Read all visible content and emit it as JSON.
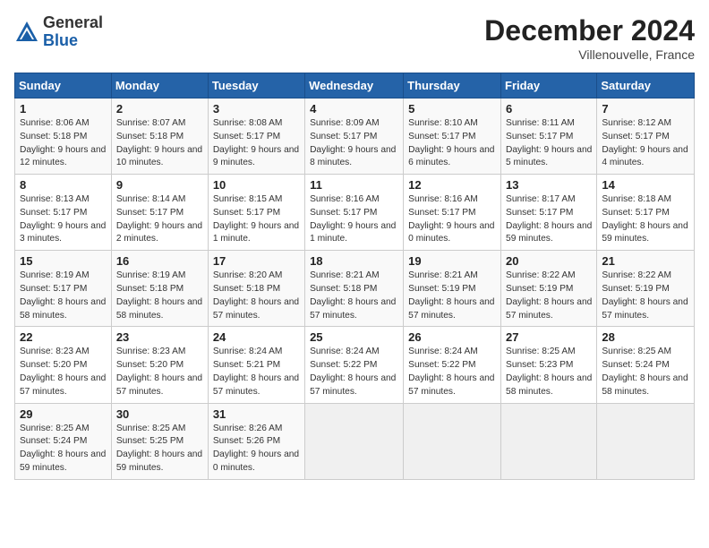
{
  "header": {
    "logo_general": "General",
    "logo_blue": "Blue",
    "month_title": "December 2024",
    "location": "Villenouvelle, France"
  },
  "days_of_week": [
    "Sunday",
    "Monday",
    "Tuesday",
    "Wednesday",
    "Thursday",
    "Friday",
    "Saturday"
  ],
  "weeks": [
    [
      {
        "day": "1",
        "info": "Sunrise: 8:06 AM\nSunset: 5:18 PM\nDaylight: 9 hours and 12 minutes."
      },
      {
        "day": "2",
        "info": "Sunrise: 8:07 AM\nSunset: 5:18 PM\nDaylight: 9 hours and 10 minutes."
      },
      {
        "day": "3",
        "info": "Sunrise: 8:08 AM\nSunset: 5:17 PM\nDaylight: 9 hours and 9 minutes."
      },
      {
        "day": "4",
        "info": "Sunrise: 8:09 AM\nSunset: 5:17 PM\nDaylight: 9 hours and 8 minutes."
      },
      {
        "day": "5",
        "info": "Sunrise: 8:10 AM\nSunset: 5:17 PM\nDaylight: 9 hours and 6 minutes."
      },
      {
        "day": "6",
        "info": "Sunrise: 8:11 AM\nSunset: 5:17 PM\nDaylight: 9 hours and 5 minutes."
      },
      {
        "day": "7",
        "info": "Sunrise: 8:12 AM\nSunset: 5:17 PM\nDaylight: 9 hours and 4 minutes."
      }
    ],
    [
      {
        "day": "8",
        "info": "Sunrise: 8:13 AM\nSunset: 5:17 PM\nDaylight: 9 hours and 3 minutes."
      },
      {
        "day": "9",
        "info": "Sunrise: 8:14 AM\nSunset: 5:17 PM\nDaylight: 9 hours and 2 minutes."
      },
      {
        "day": "10",
        "info": "Sunrise: 8:15 AM\nSunset: 5:17 PM\nDaylight: 9 hours and 1 minute."
      },
      {
        "day": "11",
        "info": "Sunrise: 8:16 AM\nSunset: 5:17 PM\nDaylight: 9 hours and 1 minute."
      },
      {
        "day": "12",
        "info": "Sunrise: 8:16 AM\nSunset: 5:17 PM\nDaylight: 9 hours and 0 minutes."
      },
      {
        "day": "13",
        "info": "Sunrise: 8:17 AM\nSunset: 5:17 PM\nDaylight: 8 hours and 59 minutes."
      },
      {
        "day": "14",
        "info": "Sunrise: 8:18 AM\nSunset: 5:17 PM\nDaylight: 8 hours and 59 minutes."
      }
    ],
    [
      {
        "day": "15",
        "info": "Sunrise: 8:19 AM\nSunset: 5:17 PM\nDaylight: 8 hours and 58 minutes."
      },
      {
        "day": "16",
        "info": "Sunrise: 8:19 AM\nSunset: 5:18 PM\nDaylight: 8 hours and 58 minutes."
      },
      {
        "day": "17",
        "info": "Sunrise: 8:20 AM\nSunset: 5:18 PM\nDaylight: 8 hours and 57 minutes."
      },
      {
        "day": "18",
        "info": "Sunrise: 8:21 AM\nSunset: 5:18 PM\nDaylight: 8 hours and 57 minutes."
      },
      {
        "day": "19",
        "info": "Sunrise: 8:21 AM\nSunset: 5:19 PM\nDaylight: 8 hours and 57 minutes."
      },
      {
        "day": "20",
        "info": "Sunrise: 8:22 AM\nSunset: 5:19 PM\nDaylight: 8 hours and 57 minutes."
      },
      {
        "day": "21",
        "info": "Sunrise: 8:22 AM\nSunset: 5:19 PM\nDaylight: 8 hours and 57 minutes."
      }
    ],
    [
      {
        "day": "22",
        "info": "Sunrise: 8:23 AM\nSunset: 5:20 PM\nDaylight: 8 hours and 57 minutes."
      },
      {
        "day": "23",
        "info": "Sunrise: 8:23 AM\nSunset: 5:20 PM\nDaylight: 8 hours and 57 minutes."
      },
      {
        "day": "24",
        "info": "Sunrise: 8:24 AM\nSunset: 5:21 PM\nDaylight: 8 hours and 57 minutes."
      },
      {
        "day": "25",
        "info": "Sunrise: 8:24 AM\nSunset: 5:22 PM\nDaylight: 8 hours and 57 minutes."
      },
      {
        "day": "26",
        "info": "Sunrise: 8:24 AM\nSunset: 5:22 PM\nDaylight: 8 hours and 57 minutes."
      },
      {
        "day": "27",
        "info": "Sunrise: 8:25 AM\nSunset: 5:23 PM\nDaylight: 8 hours and 58 minutes."
      },
      {
        "day": "28",
        "info": "Sunrise: 8:25 AM\nSunset: 5:24 PM\nDaylight: 8 hours and 58 minutes."
      }
    ],
    [
      {
        "day": "29",
        "info": "Sunrise: 8:25 AM\nSunset: 5:24 PM\nDaylight: 8 hours and 59 minutes."
      },
      {
        "day": "30",
        "info": "Sunrise: 8:25 AM\nSunset: 5:25 PM\nDaylight: 8 hours and 59 minutes."
      },
      {
        "day": "31",
        "info": "Sunrise: 8:26 AM\nSunset: 5:26 PM\nDaylight: 9 hours and 0 minutes."
      },
      null,
      null,
      null,
      null
    ]
  ]
}
